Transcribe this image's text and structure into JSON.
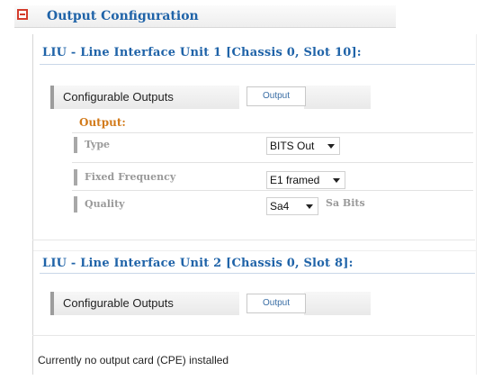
{
  "section": {
    "title": "Output Configuration",
    "collapse_icon": "minus-icon",
    "accent_color": "#d43c2c",
    "title_color": "#1f63a8"
  },
  "liu1": {
    "title": "LIU - Line Interface Unit 1 [Chassis 0, Slot 10]:",
    "configurable_label": "Configurable Outputs",
    "output_button": "Output",
    "output_heading": "Output:",
    "fields": {
      "type": {
        "label": "Type",
        "value": "BITS Out"
      },
      "fixed_frequency": {
        "label": "Fixed Frequency",
        "value": "E1 framed"
      },
      "quality": {
        "label": "Quality",
        "value": "Sa4",
        "suffix": "Sa Bits"
      }
    }
  },
  "liu2": {
    "title": "LIU - Line Interface Unit 2 [Chassis 0, Slot 8]:",
    "configurable_label": "Configurable Outputs",
    "output_button": "Output"
  },
  "footer": {
    "message": "Currently no output card (CPE) installed"
  },
  "colors": {
    "heading_orange": "#d27a1a",
    "link_blue": "#1f63a8",
    "muted_gray": "#9a9a9a"
  }
}
